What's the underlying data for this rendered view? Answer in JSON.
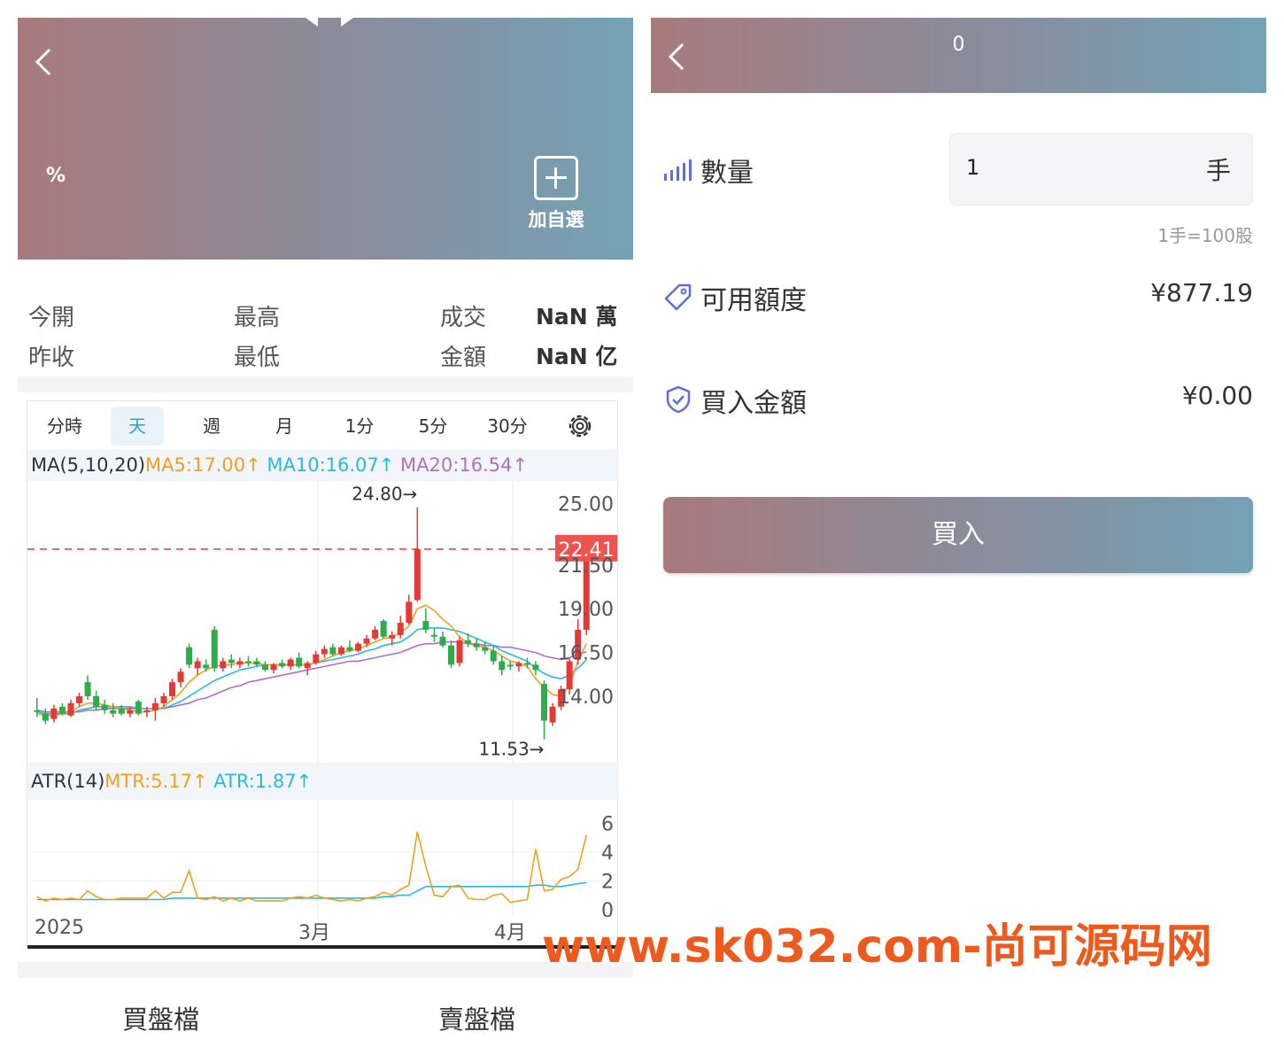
{
  "quote": {
    "percent_label": "%",
    "add_watchlist_label": "加自選",
    "stats": {
      "open_label": "今開",
      "high_label": "最高",
      "volume_label": "成交",
      "volume_value": "NaN 萬",
      "prev_close_label": "昨收",
      "low_label": "最低",
      "amount_label": "金額",
      "amount_value": "NaN 亿"
    },
    "tabs": [
      "分時",
      "天",
      "週",
      "月",
      "1分",
      "5分",
      "30分"
    ],
    "active_tab": "天",
    "ma_legend": {
      "name": "MA(5,10,20)",
      "ma5": "MA5:17.00↑",
      "ma10": "MA10:16.07↑",
      "ma20": "MA20:16.54↑"
    },
    "atr_legend": {
      "name": "ATR(14)",
      "mtr": "MTR:5.17↑",
      "atr": "ATR:1.87↑"
    },
    "order_book": {
      "buy_label": "買盤檔",
      "sell_label": "賣盤檔"
    },
    "colors": {
      "up": "#e53935",
      "down": "#2eab4a",
      "ma5": "#f0a020",
      "ma10": "#2bb8e0",
      "ma20": "#b070c0",
      "price_tag": "#ef5350"
    }
  },
  "chart_data": {
    "type": "candlestick",
    "price_axis_ticks": [
      "25.00",
      "21.50",
      "19.00",
      "16.50",
      "14.00"
    ],
    "price_axis_values": [
      25.0,
      21.5,
      19.0,
      16.5,
      14.0
    ],
    "last_price_label": "22.41",
    "last_price": 22.41,
    "max_label": "24.80→",
    "max_value": 24.8,
    "min_label": "11.53→",
    "min_value": 11.53,
    "x_labels": [
      "2025",
      "3月",
      "4月"
    ],
    "atr_axis_ticks": [
      "6",
      "4",
      "2",
      "0"
    ],
    "atr_axis_values": [
      6,
      4,
      2,
      0
    ],
    "candles": [
      {
        "o": 13.2,
        "h": 13.9,
        "l": 12.8,
        "c": 13.1
      },
      {
        "o": 13.0,
        "h": 13.3,
        "l": 12.4,
        "c": 12.6
      },
      {
        "o": 12.7,
        "h": 13.5,
        "l": 12.5,
        "c": 13.3
      },
      {
        "o": 13.4,
        "h": 13.6,
        "l": 12.9,
        "c": 13.0
      },
      {
        "o": 12.9,
        "h": 13.8,
        "l": 12.8,
        "c": 13.6
      },
      {
        "o": 13.6,
        "h": 14.2,
        "l": 13.4,
        "c": 14.0
      },
      {
        "o": 14.8,
        "h": 15.2,
        "l": 13.8,
        "c": 14.0
      },
      {
        "o": 14.0,
        "h": 14.3,
        "l": 13.2,
        "c": 13.4
      },
      {
        "o": 13.5,
        "h": 13.8,
        "l": 13.0,
        "c": 13.2
      },
      {
        "o": 13.2,
        "h": 13.6,
        "l": 12.8,
        "c": 13.0
      },
      {
        "o": 13.3,
        "h": 13.5,
        "l": 12.9,
        "c": 13.0
      },
      {
        "o": 13.0,
        "h": 13.4,
        "l": 12.8,
        "c": 13.2
      },
      {
        "o": 13.7,
        "h": 13.8,
        "l": 12.9,
        "c": 13.0
      },
      {
        "o": 13.1,
        "h": 13.4,
        "l": 12.8,
        "c": 13.2
      },
      {
        "o": 13.2,
        "h": 13.9,
        "l": 12.6,
        "c": 13.6
      },
      {
        "o": 13.6,
        "h": 14.2,
        "l": 13.4,
        "c": 14.0
      },
      {
        "o": 14.0,
        "h": 15.0,
        "l": 13.8,
        "c": 14.8
      },
      {
        "o": 14.8,
        "h": 15.6,
        "l": 14.5,
        "c": 15.4
      },
      {
        "o": 16.8,
        "h": 17.0,
        "l": 15.6,
        "c": 15.8
      },
      {
        "o": 15.6,
        "h": 16.2,
        "l": 15.2,
        "c": 16.0
      },
      {
        "o": 15.8,
        "h": 16.1,
        "l": 15.4,
        "c": 15.6
      },
      {
        "o": 17.8,
        "h": 18.0,
        "l": 15.4,
        "c": 15.6
      },
      {
        "o": 15.6,
        "h": 16.2,
        "l": 15.4,
        "c": 16.0
      },
      {
        "o": 16.1,
        "h": 16.4,
        "l": 15.6,
        "c": 15.9
      },
      {
        "o": 15.8,
        "h": 16.2,
        "l": 15.6,
        "c": 16.0
      },
      {
        "o": 16.0,
        "h": 16.3,
        "l": 15.7,
        "c": 15.9
      },
      {
        "o": 16.0,
        "h": 16.2,
        "l": 15.7,
        "c": 15.8
      },
      {
        "o": 15.8,
        "h": 16.0,
        "l": 15.4,
        "c": 15.5
      },
      {
        "o": 15.5,
        "h": 15.9,
        "l": 15.3,
        "c": 15.8
      },
      {
        "o": 15.9,
        "h": 16.1,
        "l": 15.6,
        "c": 15.7
      },
      {
        "o": 15.7,
        "h": 16.2,
        "l": 15.5,
        "c": 16.1
      },
      {
        "o": 16.2,
        "h": 16.5,
        "l": 15.6,
        "c": 15.7
      },
      {
        "o": 15.6,
        "h": 16.0,
        "l": 15.2,
        "c": 15.9
      },
      {
        "o": 15.9,
        "h": 16.6,
        "l": 15.8,
        "c": 16.4
      },
      {
        "o": 16.4,
        "h": 16.9,
        "l": 16.2,
        "c": 16.7
      },
      {
        "o": 16.8,
        "h": 17.0,
        "l": 16.3,
        "c": 16.4
      },
      {
        "o": 16.4,
        "h": 16.9,
        "l": 16.3,
        "c": 16.8
      },
      {
        "o": 16.8,
        "h": 17.2,
        "l": 16.5,
        "c": 16.6
      },
      {
        "o": 16.6,
        "h": 17.1,
        "l": 16.5,
        "c": 17.0
      },
      {
        "o": 17.0,
        "h": 17.5,
        "l": 16.8,
        "c": 17.3
      },
      {
        "o": 17.3,
        "h": 18.0,
        "l": 17.2,
        "c": 17.8
      },
      {
        "o": 18.3,
        "h": 18.4,
        "l": 17.3,
        "c": 17.4
      },
      {
        "o": 17.3,
        "h": 17.7,
        "l": 16.9,
        "c": 17.5
      },
      {
        "o": 17.5,
        "h": 18.6,
        "l": 17.3,
        "c": 18.2
      },
      {
        "o": 18.2,
        "h": 19.8,
        "l": 18.1,
        "c": 19.4
      },
      {
        "o": 19.5,
        "h": 24.8,
        "l": 19.4,
        "c": 22.4
      },
      {
        "o": 18.3,
        "h": 19.0,
        "l": 17.6,
        "c": 17.8
      },
      {
        "o": 17.5,
        "h": 17.9,
        "l": 17.1,
        "c": 17.4
      },
      {
        "o": 17.4,
        "h": 17.7,
        "l": 16.8,
        "c": 16.9
      },
      {
        "o": 16.9,
        "h": 17.2,
        "l": 15.6,
        "c": 15.8
      },
      {
        "o": 15.9,
        "h": 17.4,
        "l": 15.7,
        "c": 17.2
      },
      {
        "o": 17.2,
        "h": 17.6,
        "l": 16.8,
        "c": 17.0
      },
      {
        "o": 17.0,
        "h": 17.3,
        "l": 16.6,
        "c": 16.8
      },
      {
        "o": 16.8,
        "h": 17.1,
        "l": 16.4,
        "c": 16.6
      },
      {
        "o": 16.6,
        "h": 16.9,
        "l": 15.8,
        "c": 16.0
      },
      {
        "o": 16.0,
        "h": 16.3,
        "l": 15.2,
        "c": 15.5
      },
      {
        "o": 15.8,
        "h": 16.0,
        "l": 15.5,
        "c": 15.7
      },
      {
        "o": 15.7,
        "h": 16.0,
        "l": 15.4,
        "c": 15.9
      },
      {
        "o": 15.9,
        "h": 16.2,
        "l": 15.6,
        "c": 15.8
      },
      {
        "o": 15.8,
        "h": 16.0,
        "l": 15.2,
        "c": 15.5
      },
      {
        "o": 14.7,
        "h": 14.9,
        "l": 11.53,
        "c": 12.6
      },
      {
        "o": 12.5,
        "h": 13.6,
        "l": 12.3,
        "c": 13.4
      },
      {
        "o": 13.4,
        "h": 14.6,
        "l": 13.2,
        "c": 14.4
      },
      {
        "o": 14.4,
        "h": 16.2,
        "l": 14.1,
        "c": 16.0
      },
      {
        "o": 16.1,
        "h": 18.4,
        "l": 15.8,
        "c": 17.8
      },
      {
        "o": 17.8,
        "h": 22.4,
        "l": 17.5,
        "c": 22.41
      }
    ],
    "ma5": [
      13.0,
      12.9,
      12.9,
      13.0,
      13.1,
      13.4,
      13.6,
      13.6,
      13.5,
      13.4,
      13.3,
      13.2,
      13.1,
      13.1,
      13.2,
      13.4,
      13.8,
      14.2,
      14.8,
      15.2,
      15.5,
      15.7,
      15.8,
      15.8,
      15.9,
      15.9,
      15.9,
      15.8,
      15.8,
      15.8,
      15.8,
      15.8,
      15.8,
      15.9,
      16.1,
      16.3,
      16.5,
      16.6,
      16.7,
      16.9,
      17.1,
      17.3,
      17.4,
      17.6,
      18.0,
      19.0,
      19.2,
      18.9,
      18.4,
      18.0,
      17.4,
      17.0,
      16.9,
      16.8,
      16.6,
      16.3,
      16.0,
      15.9,
      15.7,
      15.0,
      14.5,
      14.1,
      14.0,
      14.6,
      16.0,
      17.0
    ],
    "ma10": [
      13.1,
      13.0,
      13.0,
      13.0,
      13.0,
      13.2,
      13.3,
      13.4,
      13.4,
      13.4,
      13.4,
      13.4,
      13.3,
      13.3,
      13.3,
      13.3,
      13.5,
      13.7,
      14.0,
      14.3,
      14.6,
      14.9,
      15.1,
      15.3,
      15.5,
      15.6,
      15.7,
      15.8,
      15.8,
      15.8,
      15.8,
      15.8,
      15.8,
      15.9,
      16.0,
      16.1,
      16.2,
      16.3,
      16.4,
      16.6,
      16.7,
      16.9,
      17.0,
      17.1,
      17.4,
      17.8,
      17.9,
      17.9,
      17.9,
      17.8,
      17.7,
      17.5,
      17.3,
      17.1,
      16.9,
      16.6,
      16.4,
      16.2,
      16.0,
      15.6,
      15.3,
      15.1,
      15.0,
      15.2,
      15.6,
      16.07
    ],
    "ma20": [
      13.2,
      13.1,
      13.1,
      13.1,
      13.1,
      13.1,
      13.2,
      13.2,
      13.3,
      13.3,
      13.3,
      13.3,
      13.3,
      13.3,
      13.3,
      13.3,
      13.4,
      13.5,
      13.6,
      13.8,
      13.9,
      14.1,
      14.3,
      14.5,
      14.6,
      14.8,
      14.9,
      15.0,
      15.1,
      15.2,
      15.3,
      15.4,
      15.5,
      15.6,
      15.7,
      15.8,
      15.9,
      16.0,
      16.0,
      16.1,
      16.2,
      16.3,
      16.4,
      16.5,
      16.7,
      16.9,
      17.0,
      17.0,
      17.1,
      17.1,
      17.1,
      17.0,
      17.0,
      16.9,
      16.9,
      16.8,
      16.8,
      16.7,
      16.6,
      16.5,
      16.3,
      16.2,
      16.1,
      16.2,
      16.4,
      16.54
    ],
    "mtr": [
      0.9,
      0.6,
      0.8,
      0.7,
      0.8,
      0.7,
      1.3,
      0.9,
      0.7,
      0.7,
      0.8,
      0.8,
      0.8,
      0.8,
      1.3,
      0.8,
      1.2,
      1.2,
      2.7,
      0.8,
      0.7,
      0.9,
      0.6,
      0.8,
      0.6,
      0.8,
      0.6,
      0.6,
      0.6,
      0.6,
      0.8,
      0.9,
      0.8,
      1.0,
      0.8,
      0.7,
      0.6,
      0.7,
      0.6,
      0.8,
      0.9,
      1.2,
      1.0,
      1.4,
      1.7,
      5.4,
      3.0,
      1.0,
      0.9,
      1.6,
      1.7,
      0.8,
      0.7,
      0.7,
      1.0,
      1.1,
      0.5,
      0.6,
      0.7,
      4.2,
      1.3,
      1.4,
      2.1,
      2.3,
      2.8,
      5.17
    ],
    "atr": [
      0.7,
      0.7,
      0.7,
      0.7,
      0.7,
      0.7,
      0.7,
      0.7,
      0.7,
      0.7,
      0.7,
      0.7,
      0.7,
      0.7,
      0.7,
      0.7,
      0.8,
      0.8,
      0.8,
      0.8,
      0.8,
      0.8,
      0.8,
      0.8,
      0.8,
      0.8,
      0.8,
      0.8,
      0.8,
      0.8,
      0.8,
      0.8,
      0.8,
      0.8,
      0.8,
      0.8,
      0.8,
      0.8,
      0.8,
      0.8,
      0.8,
      0.9,
      0.9,
      1.0,
      1.0,
      1.3,
      1.6,
      1.6,
      1.6,
      1.6,
      1.6,
      1.6,
      1.6,
      1.6,
      1.6,
      1.6,
      1.6,
      1.6,
      1.6,
      1.7,
      1.7,
      1.6,
      1.6,
      1.7,
      1.8,
      1.87
    ]
  },
  "order": {
    "header_title": "0",
    "quantity_label": "數量",
    "quantity_value": "1",
    "quantity_unit": "手",
    "lot_hint": "1手=100股",
    "available_label": "可用額度",
    "available_value": "¥877.19",
    "buy_amount_label": "買入金額",
    "buy_amount_value": "¥0.00",
    "buy_button_label": "買入"
  },
  "watermark": "www.sk032.com-尚可源码网"
}
